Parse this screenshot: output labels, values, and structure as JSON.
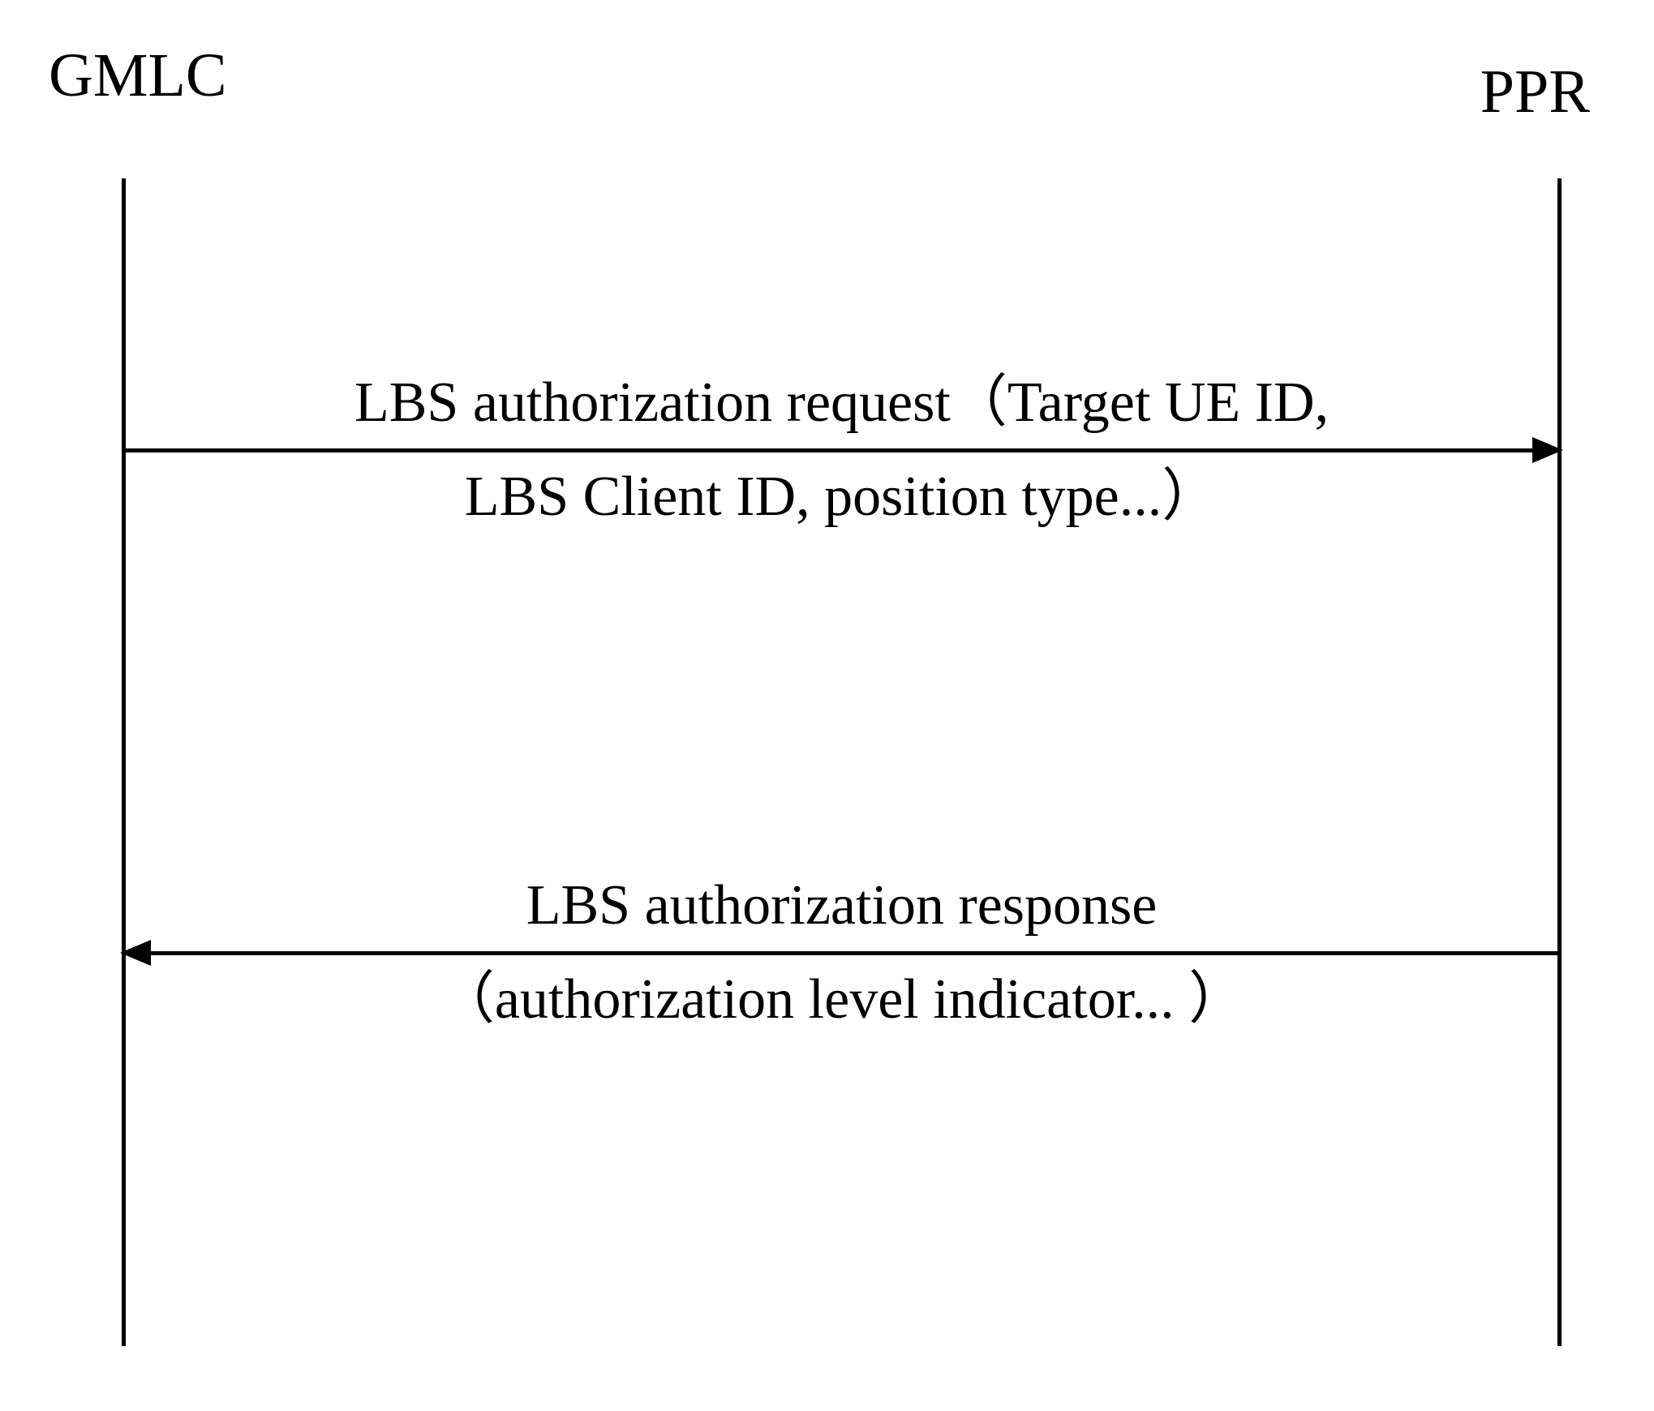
{
  "diagram": {
    "actors": {
      "left": "GMLC",
      "right": "PPR"
    },
    "messages": [
      {
        "direction": "right",
        "text_above": "LBS authorization request（Target UE ID,",
        "text_below": "LBS  Client ID, position type...）"
      },
      {
        "direction": "left",
        "text_above": "LBS authorization response",
        "text_below": "（authorization level indicator... ）"
      }
    ]
  }
}
